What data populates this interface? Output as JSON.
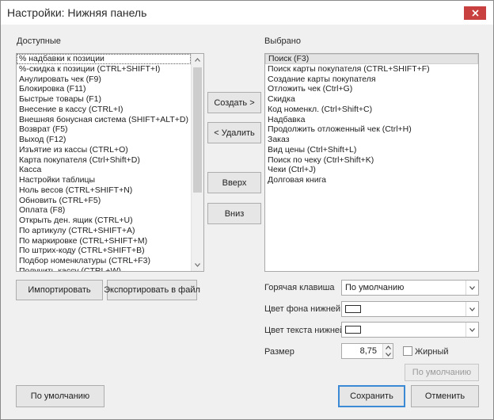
{
  "window": {
    "title": "Настройки: Нижняя панель"
  },
  "available": {
    "label": "Доступные",
    "items": [
      "% надбавки к позиции",
      "%-скидка к позиции (CTRL+SHIFT+I)",
      "Анулировать чек (F9)",
      "Блокировка (F11)",
      "Быстрые товары (F1)",
      "Внесение в кассу (CTRL+I)",
      "Внешняя бонусная система (SHIFT+ALT+D)",
      "Возврат (F5)",
      "Выход (F12)",
      "Изъятие из кассы (CTRL+O)",
      "Карта покупателя (Ctrl+Shift+D)",
      "Касса",
      "Настройки таблицы",
      "Ноль весов (CTRL+SHIFT+N)",
      "Обновить (CTRL+F5)",
      "Оплата (F8)",
      "Открыть ден. ящик (CTRL+U)",
      "По артикулу (CTRL+SHIFT+A)",
      "По маркировке (CTRL+SHIFT+M)",
      "По штрих-коду (CTRL+SHIFT+B)",
      "Подбор номенклатуры (CTRL+F3)",
      "Получить кассу (CTRL+W)"
    ]
  },
  "selected": {
    "label": "Выбрано",
    "items": [
      "Поиск (F3)",
      "Поиск карты покупателя (CTRL+SHIFT+F)",
      "Создание карты покупателя",
      "Отложить чек (Ctrl+G)",
      "Скидка",
      "Код номенкл. (Ctrl+Shift+C)",
      "Надбавка",
      "Продолжить отложенный чек (Ctrl+H)",
      "Заказ",
      "Вид цены (Ctrl+Shift+L)",
      "Поиск по чеку (Ctrl+Shift+K)",
      "Чеки (Ctrl+J)",
      "Долговая книга"
    ]
  },
  "buttons": {
    "create": "Создать  >",
    "delete": "<  Удалить",
    "up": "Вверх",
    "down": "Вниз",
    "import": "Импортировать",
    "export": "Экспортировать в файл",
    "default_left": "По умолчанию",
    "default_font": "По умолчанию",
    "save": "Сохранить",
    "cancel": "Отменить"
  },
  "props": {
    "hotkey_label": "Горячая клавиша",
    "hotkey_value": "По умолчанию",
    "bg_label": "Цвет фона нижней пан",
    "text_color_label": "Цвет текста нижней па",
    "size_label": "Размер",
    "size_value": "8,75",
    "bold_label": "Жирный"
  },
  "colors": {
    "close_button": "#c94040",
    "primary_border": "#3c8ad6",
    "selected_item_bg": "#e3e3e3"
  },
  "icons": {
    "close": "close-icon",
    "dropdown": "chevron-down-icon",
    "scroll_up": "scroll-up-arrow-icon",
    "scroll_down": "scroll-down-arrow-icon"
  }
}
